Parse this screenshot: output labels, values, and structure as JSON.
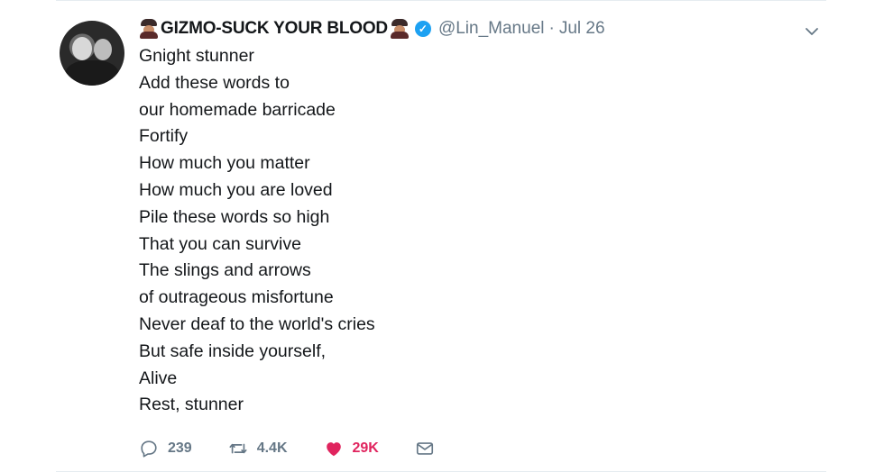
{
  "tweet": {
    "display_name": "GIZMO-SUCK YOUR BLOOD",
    "name_emoji_left": "vampire-emoji",
    "name_emoji_right": "vampire-emoji",
    "handle": "@Lin_Manuel",
    "separator": "·",
    "date": "Jul 26",
    "lines": [
      "Gnight stunner",
      "Add these words to",
      "our homemade barricade",
      "Fortify",
      "How much you matter",
      "How much you are loved",
      "Pile these words so high",
      "That you can survive",
      "The slings and arrows",
      "of outrageous misfortune",
      "Never deaf to the world's cries",
      "But safe inside yourself,",
      "Alive",
      "Rest, stunner"
    ],
    "actions": {
      "replies": "239",
      "retweets": "4.4K",
      "likes": "29K"
    },
    "icons": {
      "reply": "reply-icon",
      "retweet": "retweet-icon",
      "like": "heart-icon",
      "dm": "envelope-icon",
      "menu": "chevron-down-icon",
      "verified": "verified-badge-icon"
    },
    "colors": {
      "like_active": "#e0245e",
      "verified": "#1da1f2",
      "muted": "#657786"
    }
  }
}
